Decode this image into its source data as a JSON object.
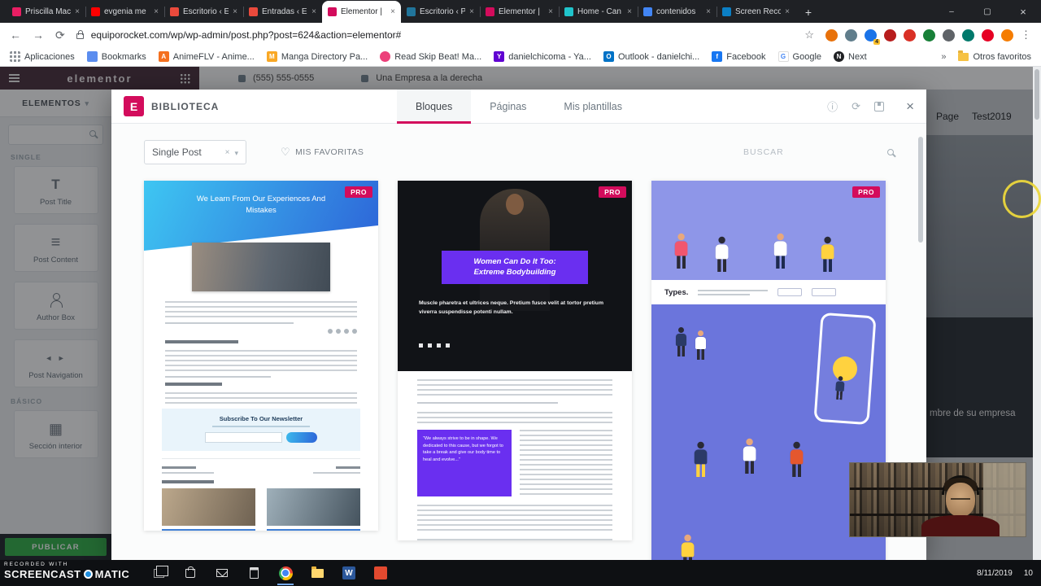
{
  "palette": {
    "accent_pink": "#d30c5c",
    "publish_green": "#37b24d",
    "library_purple": "#6a2ff0",
    "hero_blue_start": "#3ec6f2",
    "hero_blue_end": "#2d64d8",
    "illustration_periwinkle": "#8e96e8"
  },
  "browser": {
    "tabs": [
      {
        "label": "Priscilla Mac"
      },
      {
        "label": "evgenia me"
      },
      {
        "label": "Escritorio ‹ E"
      },
      {
        "label": "Entradas ‹ E"
      },
      {
        "label": "Elementor |"
      },
      {
        "label": "Escritorio ‹ P"
      },
      {
        "label": "Elementor |"
      },
      {
        "label": "Home - Can"
      },
      {
        "label": "contenidos"
      },
      {
        "label": "Screen Reco"
      }
    ],
    "url": "equiporocket.com/wp/wp-admin/post.php?post=624&action=elementor#",
    "bookmarks": [
      "Aplicaciones",
      "Bookmarks",
      "AnimeFLV - Anime...",
      "Manga Directory Pa...",
      "Read Skip Beat! Ma...",
      "danielchicoma - Ya...",
      "Outlook - danielchi...",
      "Facebook",
      "Google",
      "Next"
    ],
    "others_label": "Otros favoritos",
    "extension_badge": "4"
  },
  "editor": {
    "brand": "elementor",
    "topbar_phone": "(555) 555-0555",
    "topbar_company": "Una Empresa a la derecha",
    "panel_tab": "ELEMENTOS",
    "category_single": "SINGLE",
    "category_basic": "BÁSICO",
    "widgets": [
      "Post Title",
      "Post Content",
      "Author Box",
      "Post Navigation",
      "Sección interior"
    ],
    "publish_label": "PUBLICAR",
    "page_link_1": "Page",
    "page_link_2": "Test2019",
    "partial_heading": "mbre de su empresa"
  },
  "library": {
    "title": "BIBLIOTECA",
    "tabs": [
      "Bloques",
      "Páginas",
      "Mis plantillas"
    ],
    "filter_value": "Single Post",
    "favorites_label": "MIS FAVORITAS",
    "search_placeholder": "BUSCAR",
    "pro_badge": "PRO",
    "card1": {
      "title": "We Learn From Our Experiences And Mistakes",
      "newsletter_title": "Subscribe To Our Newsletter"
    },
    "card2": {
      "title_line1": "Women Can Do It Too:",
      "title_line2": "Extreme Bodybuilding",
      "intro": "Muscle pharetra et ultrices neque. Pretium fusce velit at tortor pretium viverra suspendisse potenti nullam.",
      "quote": "“We always strive to be in shape. We dedicated to this cause, but we forgot to take a break and give our body time to heal and evolve...”"
    },
    "card3": {
      "heading": "Types."
    }
  },
  "recording": {
    "watermark_line": "RECORDED WITH",
    "watermark_brand": "SCREENCAST",
    "watermark_suffix": "MATIC"
  },
  "taskbar": {
    "date": "8/11/2019",
    "notification_count": "10"
  }
}
